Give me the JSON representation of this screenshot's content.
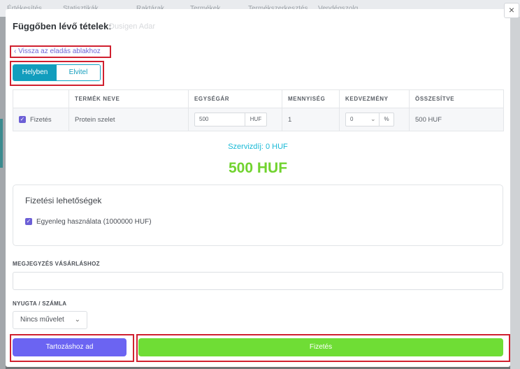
{
  "background": {
    "nav_items": [
      "Értékesítés",
      "Statisztikák",
      "Raktárak",
      "Termékek",
      "Termékszerkesztés",
      "Vendégszolg."
    ]
  },
  "modal": {
    "title": "Függőben lévő tételek:",
    "title_ghost": "Dusigen Adar",
    "close_label": "×",
    "back_link": "Vissza az eladás ablakhoz",
    "toggle": {
      "active": "Helyben",
      "inactive": "Elvitel"
    },
    "table": {
      "headers": [
        "",
        "TERMÉK NEVE",
        "EGYSÉGÁR",
        "MENNYISÉG",
        "KEDVEZMÉNY",
        "ÖSSZESÍTVE"
      ],
      "row": {
        "checkbox_label": "Fizetés",
        "product": "Protein szelet",
        "unit_price": "500",
        "unit_price_unit": "HUF",
        "quantity": "1",
        "discount": "0",
        "discount_unit": "%",
        "total": "500 HUF"
      }
    },
    "service_fee": "Szervizdíj: 0 HUF",
    "grand_total": "500 HUF",
    "payment_options": {
      "heading": "Fizetési lehetőségek",
      "balance_label": "Egyenleg használata (1000000 HUF)"
    },
    "note_label": "MEGJEGYZÉS VÁSÁRLÁSHOZ",
    "note_value": "",
    "receipt_label": "NYUGTA / SZÁMLA",
    "receipt_selected": "Nincs művelet",
    "debt_button": "Tartozáshoz ad",
    "pay_button": "Fizetés"
  },
  "colors": {
    "accent_purple": "#6b64f2",
    "pay_green": "#6fdd35",
    "toggle_teal": "#129dbd",
    "highlight_red": "#d0202f"
  }
}
